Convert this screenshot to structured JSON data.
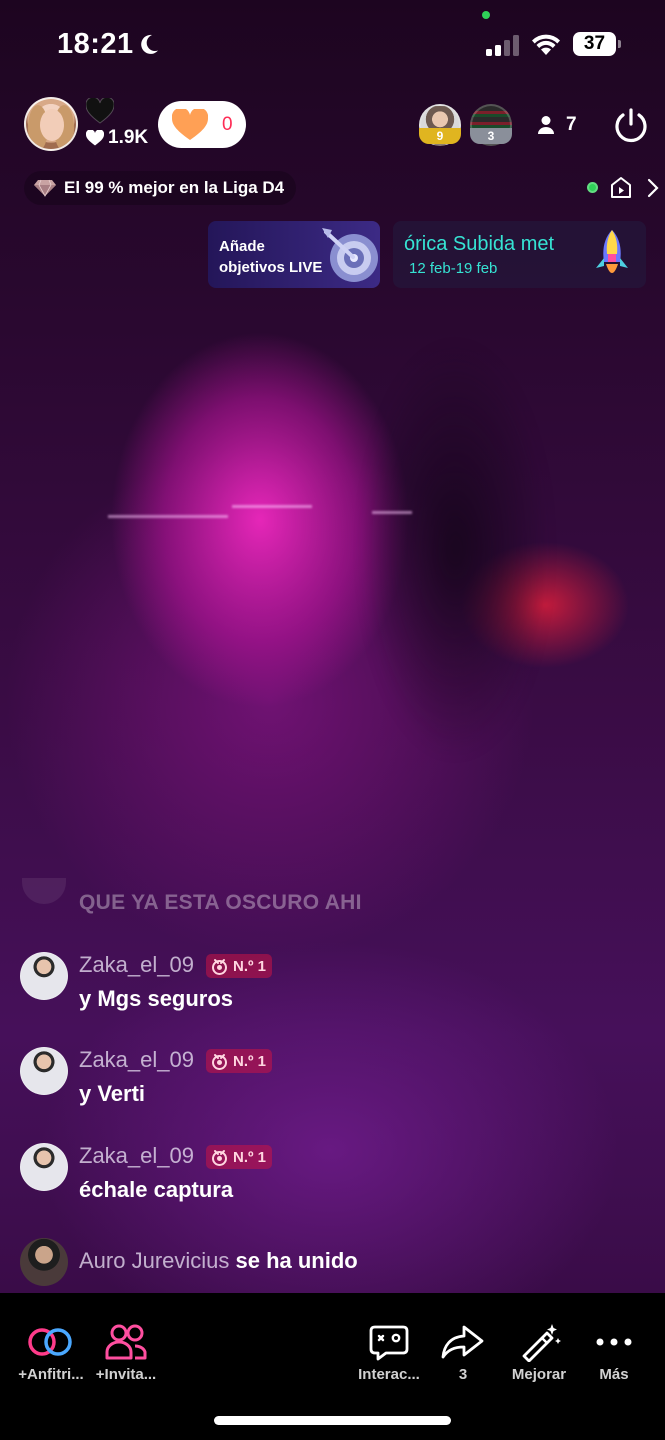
{
  "status_bar": {
    "time": "18:21",
    "battery": "37",
    "icons": [
      "moon-icon",
      "signal-icon",
      "wifi-icon",
      "battery-icon"
    ]
  },
  "host": {
    "likes": "1.9K",
    "gift_count": "0"
  },
  "viewers": {
    "top1_rank": "9",
    "top2_rank": "3",
    "count": "7"
  },
  "league": {
    "text": "El 99 % mejor en la Liga D4"
  },
  "goals_card": {
    "line1": "Añade",
    "line2": "objetivos LIVE"
  },
  "event_card": {
    "title": "órica Subida met",
    "dates": "12 feb-19 feb"
  },
  "chat": {
    "faded_message": "QUE YA ESTA OSCURO AHI",
    "messages": [
      {
        "user": "Zaka_el_09",
        "badge": "N.º 1",
        "text": "y Mgs seguros"
      },
      {
        "user": "Zaka_el_09",
        "badge": "N.º 1",
        "text": "y Verti"
      },
      {
        "user": "Zaka_el_09",
        "badge": "N.º 1",
        "text": "échale captura"
      }
    ],
    "join": {
      "user": "Auro Jurevicius",
      "suffix": " se ha unido"
    }
  },
  "bottom_bar": {
    "cohost": "+Anfitri...",
    "invite": "+Invita...",
    "interact": "Interac...",
    "share_count": "3",
    "enhance": "Mejorar",
    "more": "Más"
  },
  "colors": {
    "accent_pink": "#fe2c55",
    "accent_cyan": "#36e3d3",
    "online_green": "#2fd158"
  }
}
